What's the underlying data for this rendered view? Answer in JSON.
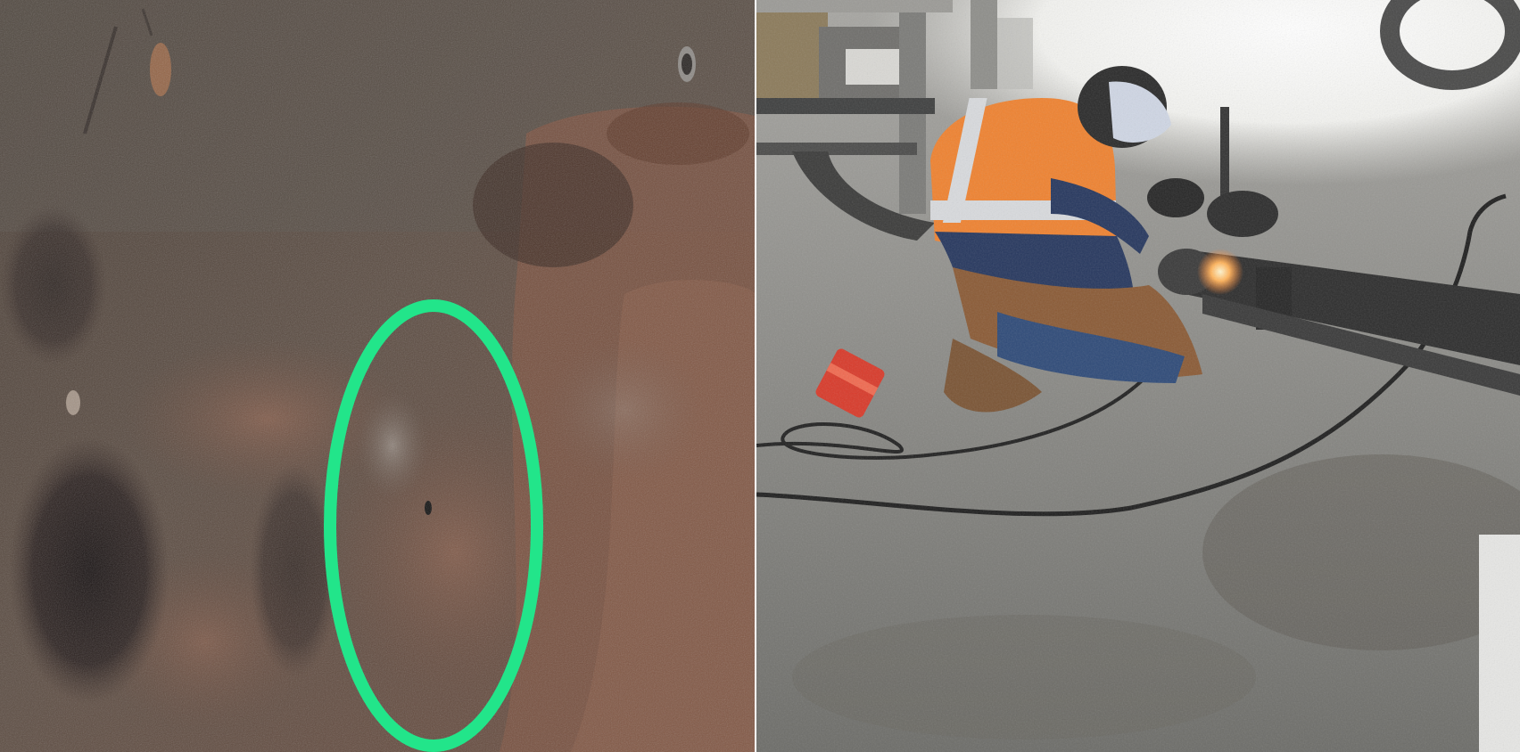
{
  "figure": {
    "panels": [
      {
        "id": "left",
        "description_name": "corroded-metal-surface-photo",
        "annotation": {
          "shape": "ellipse",
          "color": "#22e58a"
        }
      },
      {
        "id": "right",
        "description_name": "welding-repair-photo"
      }
    ]
  }
}
